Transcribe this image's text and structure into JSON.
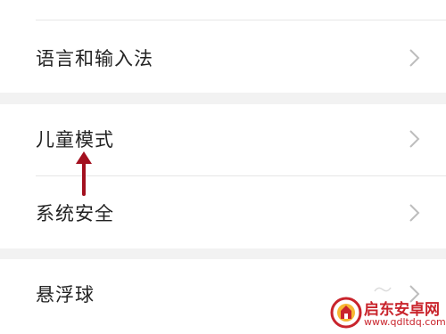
{
  "settings": {
    "items": [
      {
        "label": "语言和输入法",
        "icon": "chevron-right-icon"
      },
      {
        "label": "儿童模式",
        "icon": "chevron-right-icon"
      },
      {
        "label": "系统安全",
        "icon": "chevron-right-icon"
      },
      {
        "label": "悬浮球",
        "icon": "chevron-right-icon"
      }
    ]
  },
  "watermark": {
    "name": "启东安卓网",
    "url": "www.qdltdq.com",
    "color": "#c9242c"
  },
  "colors": {
    "background": "#f2f2f2",
    "card": "#ffffff",
    "text": "#222222",
    "chevron": "#bdbdbd",
    "annotation_arrow": "#a3101f"
  }
}
